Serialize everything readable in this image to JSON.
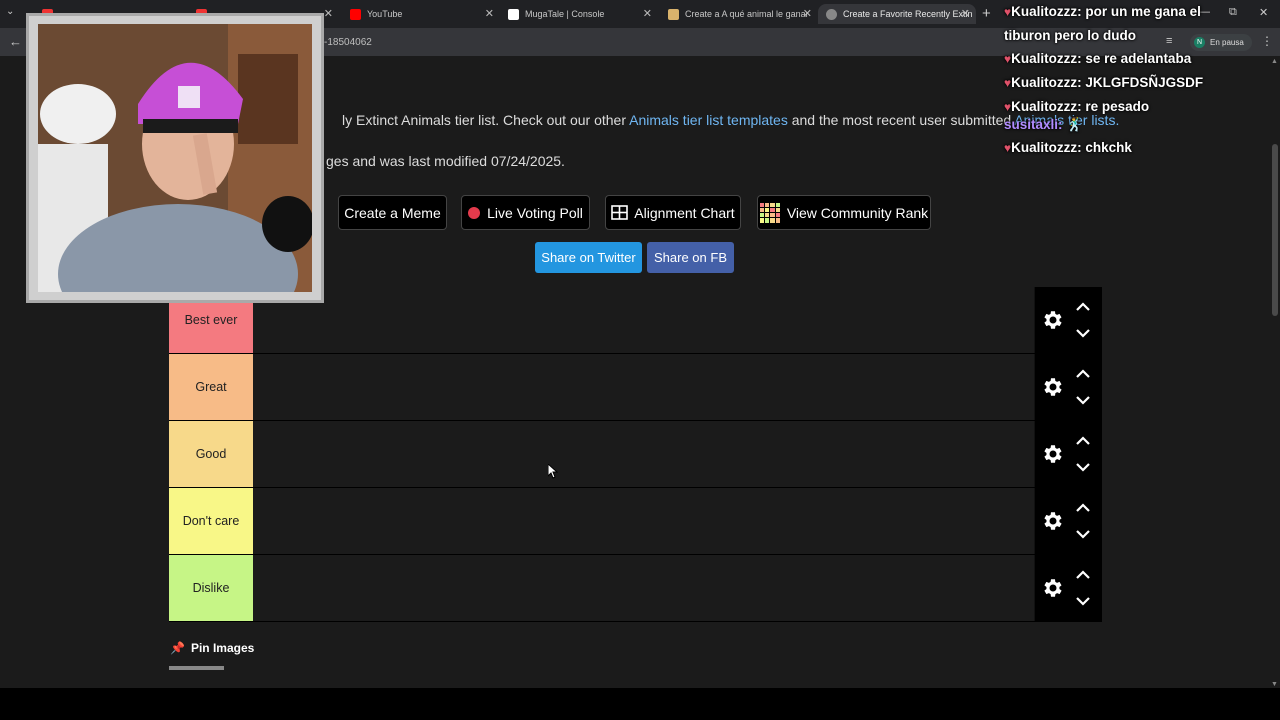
{
  "browser": {
    "tabs": [
      {
        "label": "",
        "active": false
      },
      {
        "label": "",
        "active": false
      },
      {
        "label": "YouTube",
        "active": false
      },
      {
        "label": "MugaTale | Console",
        "active": false
      },
      {
        "label": "Create a A qué animal le ganar",
        "active": false
      },
      {
        "label": "Create a Favorite Recently Extin",
        "active": true
      }
    ],
    "url": "-18504062",
    "profile_initial": "N",
    "paused_label": "En pausa"
  },
  "page": {
    "intro_prefix": "ly Extinct Animals tier list. Check out our other ",
    "intro_link1": "Animals tier list templates",
    "intro_mid": " and the most recent user submitted ",
    "intro_link2": "Animals tier lists.",
    "modified": "ges and was last modified 07/24/2025.",
    "buttons": {
      "meme": "Create a Meme",
      "poll": "Live Voting Poll",
      "alignment": "Alignment Chart",
      "community": "View Community Rank"
    },
    "share": {
      "twitter": "Share on Twitter",
      "fb": "Share on FB"
    },
    "tiers": [
      {
        "label": "Best ever",
        "color": "#f47a80"
      },
      {
        "label": "Great",
        "color": "#f7bb87"
      },
      {
        "label": "Good",
        "color": "#f7d98a"
      },
      {
        "label": "Don't care",
        "color": "#f8f787"
      },
      {
        "label": "Dislike",
        "color": "#c6f586"
      }
    ],
    "pin_label": "Pin Images"
  },
  "chat": {
    "partial_top": "por un me gana el",
    "messages": [
      {
        "user": "",
        "text": "tiburon pero lo dudo"
      },
      {
        "user": "Kualitozzz:",
        "text": "se re adelantaba"
      },
      {
        "user": "Kualitozzz:",
        "text": "JKLGFDSÑJGSDF"
      },
      {
        "user": "Kualitozzz:",
        "text": "re pesado"
      },
      {
        "user": "susitaxli:",
        "text": "🕺"
      },
      {
        "user": "Kualitozzz:",
        "text": "chkchk"
      }
    ]
  }
}
